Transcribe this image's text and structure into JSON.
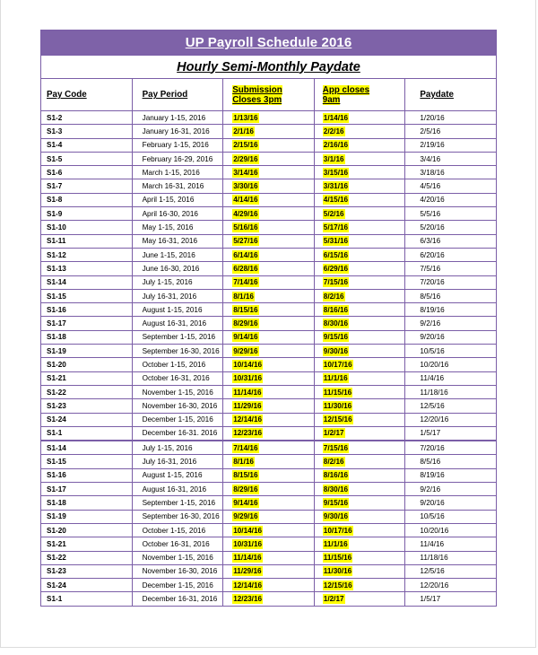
{
  "document": {
    "title": "UP Payroll Schedule 2016",
    "subtitle": "Hourly Semi-Monthly Paydate",
    "accent_purple": "#7e62a8",
    "highlight_yellow": "#ffff00",
    "border_purple": "#7b5ea7"
  },
  "table": {
    "headers": {
      "pay_code": "Pay Code",
      "pay_period": "Pay Period",
      "submission_line1": "Submission",
      "submission_line2": "Closes 3pm",
      "app_closes_line1": "App closes",
      "app_closes_line2": "9am",
      "paydate": "Paydate"
    },
    "sections": [
      {
        "rows": [
          {
            "code": "S1-2",
            "period": "January 1-15, 2016",
            "submission": "1/13/16",
            "app_closes": "1/14/16",
            "paydate": "1/20/16"
          },
          {
            "code": "S1-3",
            "period": "January 16-31, 2016",
            "submission": "2/1/16",
            "app_closes": "2/2/16",
            "paydate": "2/5/16"
          },
          {
            "code": "S1-4",
            "period": "February 1-15, 2016",
            "submission": "2/15/16",
            "app_closes": "2/16/16",
            "paydate": "2/19/16"
          },
          {
            "code": "S1-5",
            "period": "February 16-29, 2016",
            "submission": "2/29/16",
            "app_closes": "3/1/16",
            "paydate": "3/4/16"
          },
          {
            "code": "S1-6",
            "period": "March 1-15, 2016",
            "submission": "3/14/16",
            "app_closes": "3/15/16",
            "paydate": "3/18/16"
          },
          {
            "code": "S1-7",
            "period": "March 16-31, 2016",
            "submission": "3/30/16",
            "app_closes": "3/31/16",
            "paydate": "4/5/16"
          },
          {
            "code": "S1-8",
            "period": "April 1-15, 2016",
            "submission": "4/14/16",
            "app_closes": "4/15/16",
            "paydate": "4/20/16"
          },
          {
            "code": "S1-9",
            "period": "April 16-30, 2016",
            "submission": "4/29/16",
            "app_closes": "5/2/16",
            "paydate": "5/5/16"
          },
          {
            "code": "S1-10",
            "period": "May 1-15, 2016",
            "submission": "5/16/16",
            "app_closes": "5/17/16",
            "paydate": "5/20/16"
          },
          {
            "code": "S1-11",
            "period": "May 16-31, 2016",
            "submission": "5/27/16",
            "app_closes": "5/31/16",
            "paydate": "6/3/16"
          },
          {
            "code": "S1-12",
            "period": "June 1-15, 2016",
            "submission": "6/14/16",
            "app_closes": "6/15/16",
            "paydate": "6/20/16"
          },
          {
            "code": "S1-13",
            "period": "June 16-30, 2016",
            "submission": "6/28/16",
            "app_closes": "6/29/16",
            "paydate": "7/5/16"
          },
          {
            "code": "S1-14",
            "period": "July 1-15, 2016",
            "submission": "7/14/16",
            "app_closes": "7/15/16",
            "paydate": "7/20/16"
          },
          {
            "code": "S1-15",
            "period": "July 16-31, 2016",
            "submission": "8/1/16",
            "app_closes": "8/2/16",
            "paydate": "8/5/16"
          },
          {
            "code": "S1-16",
            "period": "August 1-15, 2016",
            "submission": "8/15/16",
            "app_closes": "8/16/16",
            "paydate": "8/19/16"
          },
          {
            "code": "S1-17",
            "period": "August 16-31, 2016",
            "submission": "8/29/16",
            "app_closes": "8/30/16",
            "paydate": "9/2/16"
          },
          {
            "code": "S1-18",
            "period": "September 1-15, 2016",
            "submission": "9/14/16",
            "app_closes": "9/15/16",
            "paydate": "9/20/16"
          },
          {
            "code": "S1-19",
            "period": "September 16-30, 2016",
            "submission": "9/29/16",
            "app_closes": "9/30/16",
            "paydate": "10/5/16"
          },
          {
            "code": "S1-20",
            "period": "October 1-15, 2016",
            "submission": "10/14/16",
            "app_closes": "10/17/16",
            "paydate": "10/20/16"
          },
          {
            "code": "S1-21",
            "period": "October 16-31, 2016",
            "submission": "10/31/16",
            "app_closes": "11/1/16",
            "paydate": "11/4/16"
          },
          {
            "code": "S1-22",
            "period": "November 1-15, 2016",
            "submission": "11/14/16",
            "app_closes": "11/15/16",
            "paydate": "11/18/16"
          },
          {
            "code": "S1-23",
            "period": "November 16-30, 2016",
            "submission": "11/29/16",
            "app_closes": "11/30/16",
            "paydate": "12/5/16"
          },
          {
            "code": "S1-24",
            "period": "December 1-15, 2016",
            "submission": "12/14/16",
            "app_closes": "12/15/16",
            "paydate": "12/20/16"
          },
          {
            "code": "S1-1",
            "period": "December 16-31. 2016",
            "submission": "12/23/16",
            "app_closes": "1/2/17",
            "paydate": "1/5/17"
          }
        ]
      },
      {
        "rows": [
          {
            "code": "S1-14",
            "period": "July 1-15, 2016",
            "submission": "7/14/16",
            "app_closes": "7/15/16",
            "paydate": "7/20/16"
          },
          {
            "code": "S1-15",
            "period": "July 16-31, 2016",
            "submission": "8/1/16",
            "app_closes": "8/2/16",
            "paydate": "8/5/16"
          },
          {
            "code": "S1-16",
            "period": "August 1-15, 2016",
            "submission": "8/15/16",
            "app_closes": "8/16/16",
            "paydate": "8/19/16"
          },
          {
            "code": "S1-17",
            "period": "August 16-31, 2016",
            "submission": "8/29/16",
            "app_closes": "8/30/16",
            "paydate": "9/2/16"
          },
          {
            "code": "S1-18",
            "period": "September 1-15, 2016",
            "submission": "9/14/16",
            "app_closes": "9/15/16",
            "paydate": "9/20/16"
          },
          {
            "code": "S1-19",
            "period": "September 16-30, 2016",
            "submission": "9/29/16",
            "app_closes": "9/30/16",
            "paydate": "10/5/16"
          },
          {
            "code": "S1-20",
            "period": "October 1-15, 2016",
            "submission": "10/14/16",
            "app_closes": "10/17/16",
            "paydate": "10/20/16"
          },
          {
            "code": "S1-21",
            "period": "October 16-31, 2016",
            "submission": "10/31/16",
            "app_closes": "11/1/16",
            "paydate": "11/4/16"
          },
          {
            "code": "S1-22",
            "period": "November 1-15, 2016",
            "submission": "11/14/16",
            "app_closes": "11/15/16",
            "paydate": "11/18/16"
          },
          {
            "code": "S1-23",
            "period": "November 16-30, 2016",
            "submission": "11/29/16",
            "app_closes": "11/30/16",
            "paydate": "12/5/16"
          },
          {
            "code": "S1-24",
            "period": "December 1-15, 2016",
            "submission": "12/14/16",
            "app_closes": "12/15/16",
            "paydate": "12/20/16"
          },
          {
            "code": "S1-1",
            "period": "December 16-31, 2016",
            "submission": "12/23/16",
            "app_closes": "1/2/17",
            "paydate": "1/5/17"
          }
        ]
      }
    ]
  }
}
